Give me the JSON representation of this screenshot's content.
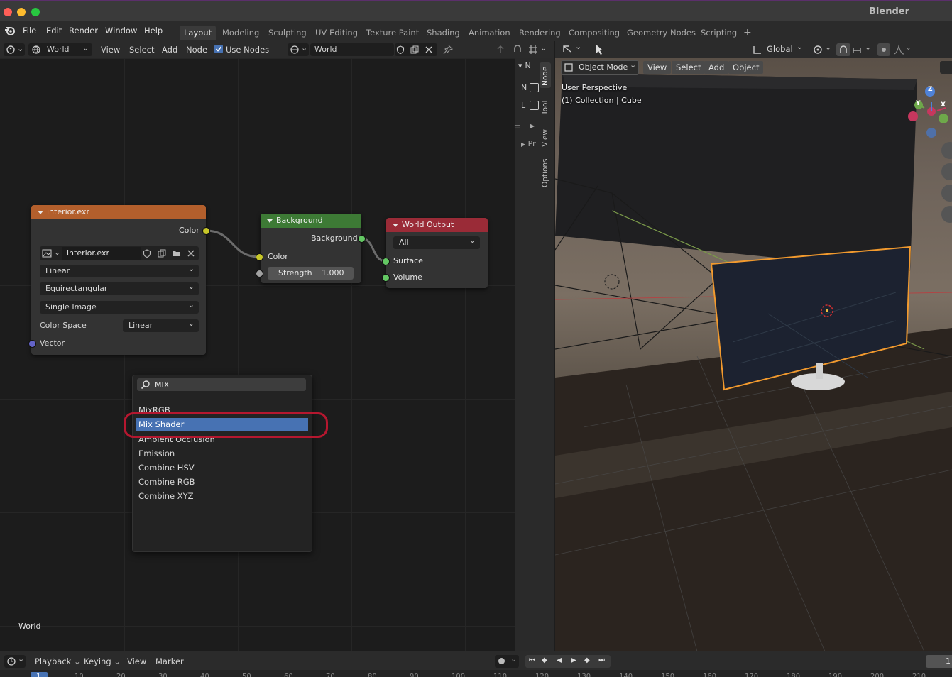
{
  "window": {
    "title": "Blender"
  },
  "menu": [
    "File",
    "Edit",
    "Render",
    "Window",
    "Help"
  ],
  "workspaces": [
    "Layout",
    "Modeling",
    "Sculpting",
    "UV Editing",
    "Texture Paint",
    "Shading",
    "Animation",
    "Rendering",
    "Compositing",
    "Geometry Nodes",
    "Scripting"
  ],
  "add_workspace": "+",
  "node_toolbar": {
    "editor_type": "World",
    "view": "View",
    "select": "Select",
    "add": "Add",
    "node": "Node",
    "use_nodes": "Use Nodes",
    "world_name": "World"
  },
  "side_tabs": [
    "Node",
    "Tool",
    "View",
    "Options"
  ],
  "side_letters": {
    "n": "N",
    "n2": "N",
    "l": "L",
    "pr": "Pr"
  },
  "nodes": {
    "image": {
      "title": "interior.exr",
      "output_color": "Color",
      "image_name": "interior.exr",
      "interpolation": "Linear",
      "projection": "Equirectangular",
      "source": "Single Image",
      "color_space_label": "Color Space",
      "color_space": "Linear",
      "input_vector": "Vector"
    },
    "background": {
      "title": "Background",
      "output": "Background",
      "input_color": "Color",
      "strength_label": "Strength",
      "strength_value": "1.000"
    },
    "world_output": {
      "title": "World Output",
      "target": "All",
      "surface": "Surface",
      "volume": "Volume"
    }
  },
  "search_popup": {
    "query": "MIX",
    "results": [
      "MixRGB",
      "Mix Shader",
      "Ambient Occlusion",
      "Emission",
      "Combine HSV",
      "Combine RGB",
      "Combine XYZ"
    ],
    "highlighted": "Mix Shader"
  },
  "editor_label": "World",
  "viewport": {
    "mode": "Object Mode",
    "view": "View",
    "select": "Select",
    "add": "Add",
    "object": "Object",
    "perspective": "User Perspective",
    "collection": "(1) Collection | Cube",
    "orientation": "Global",
    "gizmo_axes": {
      "z": "Z",
      "y": "Y",
      "x": "X"
    }
  },
  "timeline": {
    "playback": "Playback",
    "keying": "Keying",
    "view": "View",
    "marker": "Marker",
    "current_frame": "1",
    "ruler_partial": [
      "1",
      "10",
      "20",
      "30",
      "40",
      "50",
      "60",
      "70",
      "80",
      "90",
      "100",
      "110",
      "120",
      "130",
      "140",
      "150",
      "160",
      "170",
      "180",
      "190",
      "200",
      "210"
    ]
  },
  "colors": {
    "image_header": "#b35f2c",
    "background_header": "#3d7a35",
    "output_header": "#9a2b37",
    "highlight": "#4772b3",
    "annotation": "#b5172f",
    "socket_yellow": "#c7c729",
    "socket_green": "#63c763",
    "socket_purple": "#6363c7",
    "socket_grey": "#a1a1a1"
  }
}
